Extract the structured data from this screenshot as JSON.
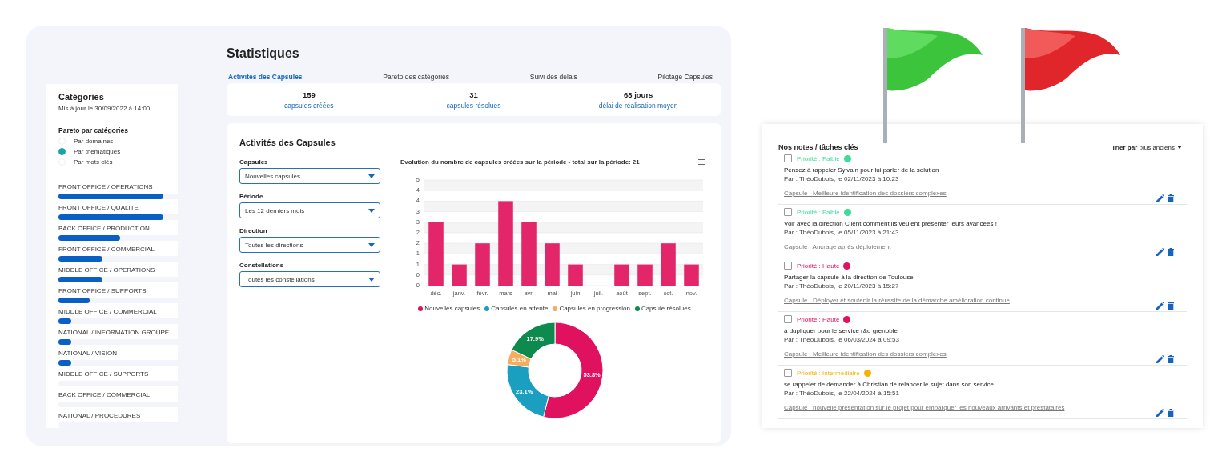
{
  "dashboard": {
    "title": "Statistiques",
    "sidebar": {
      "title": "Catégories",
      "updated": "Mis à jour le 30/09/2022 à 14:00",
      "pareto_title": "Pareto par catégories",
      "options": [
        {
          "label": "Par domaines",
          "selected": false
        },
        {
          "label": "Par thématiques",
          "selected": true
        },
        {
          "label": "Par mots clés",
          "selected": false
        }
      ],
      "categories": [
        {
          "label": "FRONT OFFICE / OPERATIONS",
          "level": 0.88
        },
        {
          "label": "FRONT OFFICE / QUALITE",
          "level": 0.88
        },
        {
          "label": "BACK OFFICE / PRODUCTION",
          "level": 0.52
        },
        {
          "label": "FRONT OFFICE / COMMERCIAL",
          "level": 0.37
        },
        {
          "label": "MIDDLE OFFICE / OPERATIONS",
          "level": 0.37
        },
        {
          "label": "FRONT OFFICE / SUPPORTS",
          "level": 0.26
        },
        {
          "label": "MIDDLE OFFICE / COMMERCIAL",
          "level": 0.11
        },
        {
          "label": "NATIONAL / INFORMATION GROUPE",
          "level": 0.11
        },
        {
          "label": "NATIONAL / VISION",
          "level": 0.11
        },
        {
          "label": "MIDDLE OFFICE / SUPPORTS"
        },
        {
          "label": "BACK OFFICE / COMMERCIAL"
        },
        {
          "label": "NATIONAL / PROCEDURES"
        }
      ]
    },
    "tabs": [
      {
        "label": "Activités des Capsules",
        "selected": true
      },
      {
        "label": "Pareto des catégories",
        "selected": false
      },
      {
        "label": "Suivi des délais",
        "selected": false
      },
      {
        "label": "Pilotage Capsules",
        "selected": false
      }
    ],
    "stats": [
      {
        "value": "159",
        "label": "capsules créées"
      },
      {
        "value": "31",
        "label": "capsules résolues"
      },
      {
        "value": "68 jours",
        "label": "délai de réalisation moyen"
      }
    ],
    "panel": {
      "title": "Activités des Capsules",
      "filters": [
        {
          "label": "Capsules",
          "value": "Nouvelles capsules"
        },
        {
          "label": "Période",
          "value": "Les 12 derniers mois"
        },
        {
          "label": "Direction",
          "value": "Toutes les directions"
        },
        {
          "label": "Constellations",
          "value": "Toutes les constellations"
        }
      ],
      "bar_chart": {
        "chart_data": {
          "type": "bar",
          "title": "Evolution du nombre de capsules créées sur la période - total sur la période: 21",
          "categories": [
            "déc.",
            "janv.",
            "févr.",
            "mars",
            "avr.",
            "mai",
            "juin",
            "juil.",
            "août",
            "sept.",
            "oct.",
            "nov."
          ],
          "series": [
            {
              "color": "#e3266a",
              "values": [
                3,
                1,
                2,
                4,
                3,
                2,
                1,
                0,
                1,
                1,
                2,
                1
              ]
            }
          ],
          "ylim": [
            0,
            5
          ],
          "grid": true,
          "yticks": [
            0,
            {
              "value": 0.5,
              "label": "0"
            },
            1,
            {
              "value": 1.5,
              "label": "1"
            },
            2,
            {
              "value": 2.5,
              "label": "2"
            },
            3,
            {
              "value": 3.5,
              "label": "3"
            },
            4,
            {
              "value": 4.5,
              "label": "4"
            },
            5
          ]
        }
      },
      "donut_chart": {
        "chart_data": {
          "type": "donut",
          "categories": [
            "Nouvelles capsules",
            "Capsules en attente",
            "Capsules en progression",
            "Capsule résolues"
          ],
          "colors": [
            "#e0115f",
            "#1a9fc0",
            "#f5ac5f",
            "#0f8a4f"
          ],
          "values": [
            53.8,
            23.1,
            5.1,
            17.9
          ],
          "data_labels": true,
          "value_labels": [
            "53.8%",
            "23.1%",
            "5.1%",
            "17.9%"
          ]
        }
      }
    }
  },
  "notes": {
    "title": "Nos notes / tâches clés",
    "sort_label": "Trier par",
    "sort_value": "plus anciens",
    "items": [
      {
        "checked": false,
        "priority": "Priorité : Faible",
        "color": "#3ddc97",
        "text": "Pensez à rappeler Sylvain pour lui parler de la solution",
        "meta": "Par : ThéoDubois, le 02/11/2023 à 10:23",
        "capsule": "Capsule : Meilleure identification des dossiers complexes"
      },
      {
        "checked": false,
        "priority": "Priorité : Faible",
        "color": "#3ddc97",
        "text": "Voir avec la direction Client comment ils veulent présenter leurs avancées !",
        "meta": "Par : ThéoDubois, le 05/11/2023 à 21:43",
        "capsule": "Capsule : Ancrage après déploiement"
      },
      {
        "checked": false,
        "priority": "Priorité : Haute",
        "color": "#e0115f",
        "text": "Partager la capsule à la direction de Toulouse",
        "meta": "Par : ThéoDubois, le 20/11/2023 à 15:27",
        "capsule": "Capsule : Déployer et soutenir la réussite de la démarche amélioration continue"
      },
      {
        "checked": false,
        "priority": "Priorité : Haute",
        "color": "#e0115f",
        "text": "à dupliquer pour le service r&d grenoble",
        "meta": "Par : ThéoDubois, le 06/03/2024 à 09:53",
        "capsule": "Capsule : Meilleure identification des dossiers complexes"
      },
      {
        "checked": false,
        "priority": "Priorité : Intermédiaire",
        "color": "#f5b400",
        "text": "se rappeler de demander à Christian de relancer le sujet dans son service",
        "meta": "Par : ThéoDubois, le 22/04/2024 à 15:51",
        "capsule": "Capsule : nouvelle présentation sur le projet pour embarquer les nouveaux arrivants et prestataires"
      }
    ]
  }
}
